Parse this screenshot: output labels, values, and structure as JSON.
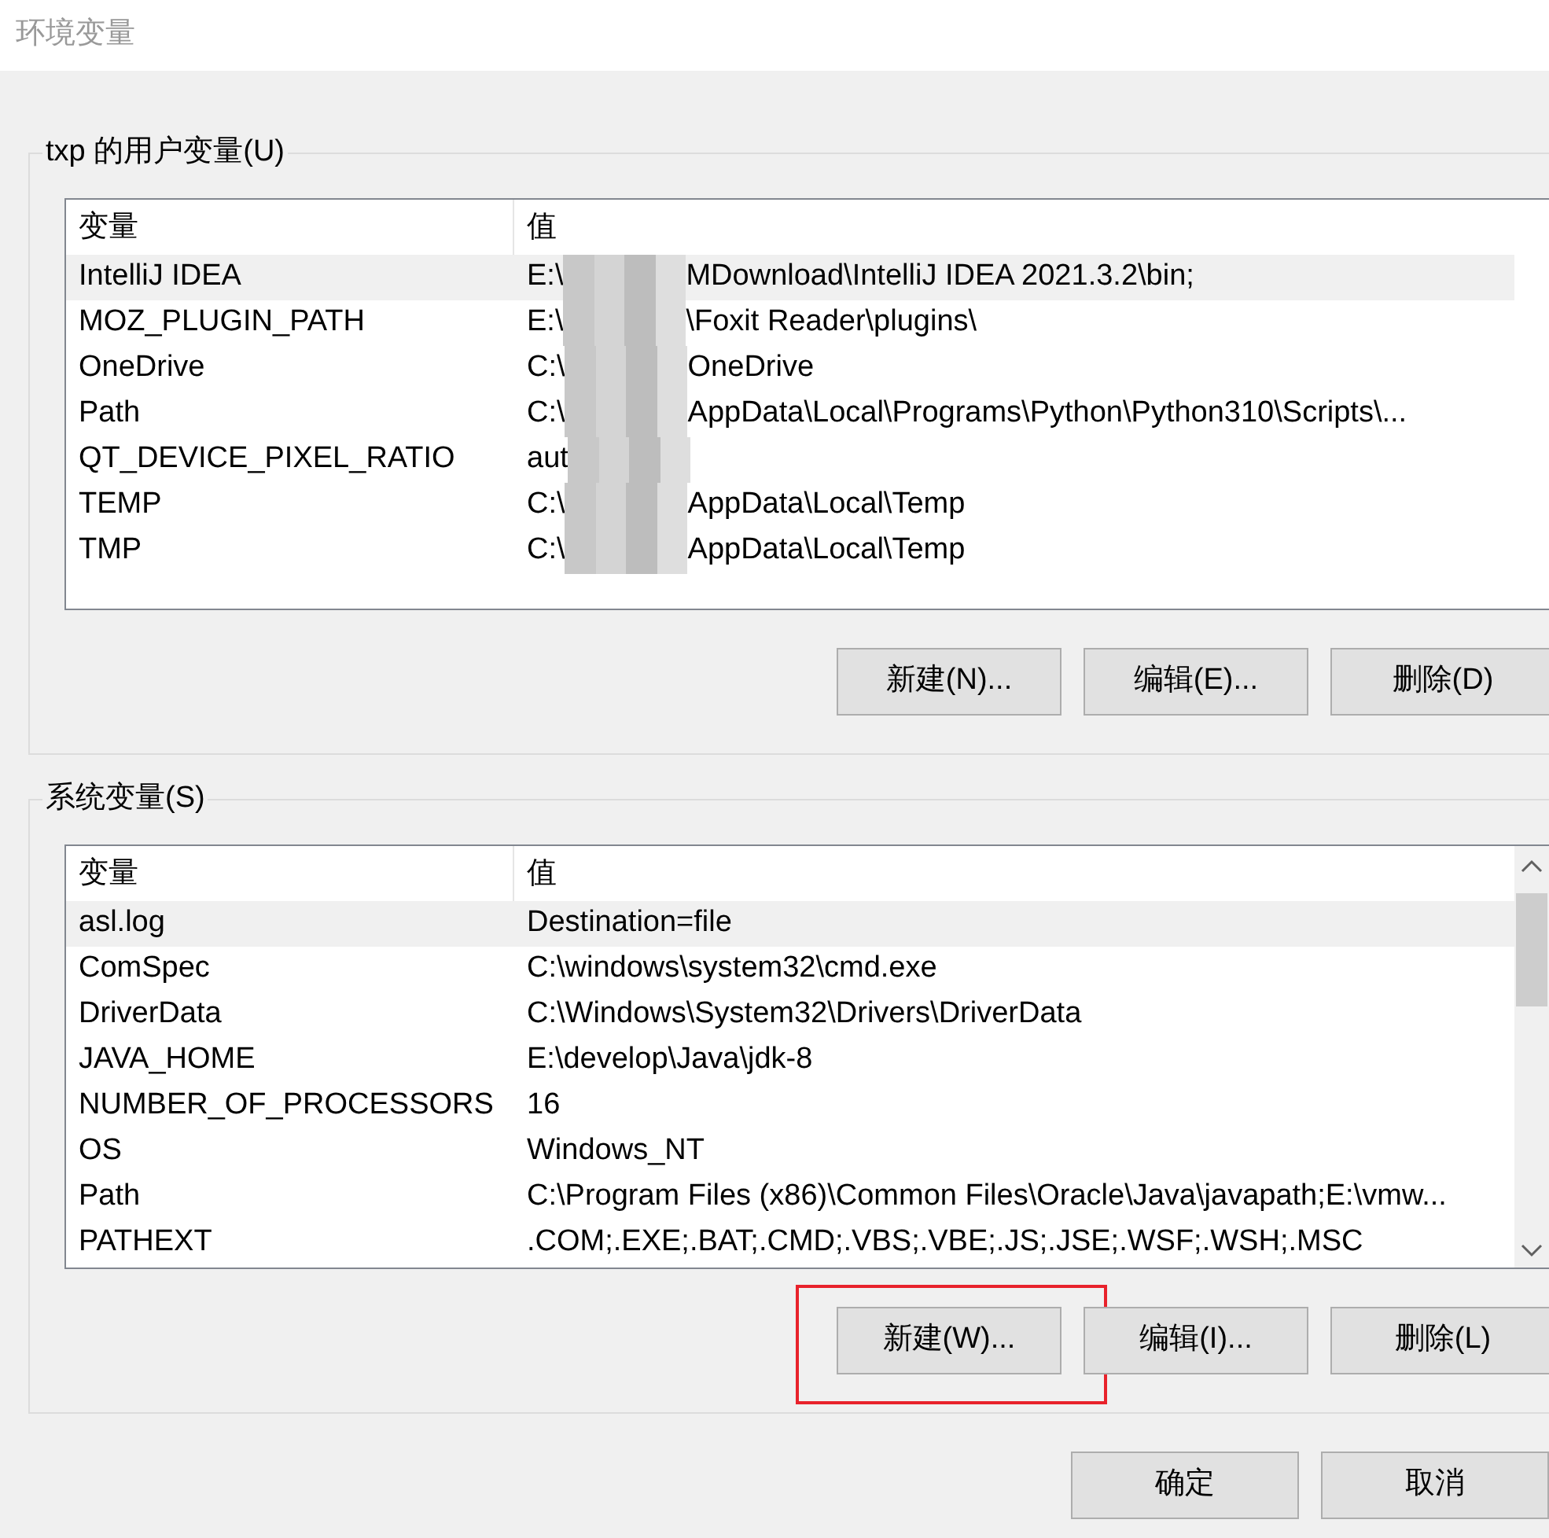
{
  "window": {
    "title": "环境变量"
  },
  "user_variables": {
    "label": "txp 的用户变量(U)",
    "columns": [
      "变量",
      "值"
    ],
    "rows": [
      {
        "name": "IntelliJ IDEA",
        "value": "E:\\",
        "value_after_redaction": "MDownload\\IntelliJ IDEA 2021.3.2\\bin;",
        "redacted": true,
        "selected": true
      },
      {
        "name": "MOZ_PLUGIN_PATH",
        "value": "E:\\",
        "value_after_redaction": "\\Foxit Reader\\plugins\\",
        "redacted": true,
        "selected": false
      },
      {
        "name": "OneDrive",
        "value": "C:\\",
        "value_after_redaction": "OneDrive",
        "redacted": true,
        "selected": false
      },
      {
        "name": "Path",
        "value": "C:\\",
        "value_after_redaction": "AppData\\Local\\Programs\\Python\\Python310\\Scripts\\...",
        "redacted": true,
        "selected": false
      },
      {
        "name": "QT_DEVICE_PIXEL_RATIO",
        "value": "aut",
        "value_after_redaction": "",
        "redacted": true,
        "selected": false
      },
      {
        "name": "TEMP",
        "value": "C:\\",
        "value_after_redaction": "AppData\\Local\\Temp",
        "redacted": true,
        "selected": false
      },
      {
        "name": "TMP",
        "value": "C:\\",
        "value_after_redaction": "AppData\\Local\\Temp",
        "redacted": true,
        "selected": false
      }
    ],
    "buttons": [
      {
        "label": "新建(N)...",
        "highlighted": false
      },
      {
        "label": "编辑(E)...",
        "highlighted": false
      },
      {
        "label": "删除(D)",
        "highlighted": false
      }
    ]
  },
  "system_variables": {
    "label": "系统变量(S)",
    "columns": [
      "变量",
      "值"
    ],
    "rows": [
      {
        "name": "asl.log",
        "value": "Destination=file",
        "redacted": false,
        "selected": true
      },
      {
        "name": "ComSpec",
        "value": "C:\\windows\\system32\\cmd.exe",
        "redacted": false,
        "selected": false
      },
      {
        "name": "DriverData",
        "value": "C:\\Windows\\System32\\Drivers\\DriverData",
        "redacted": false,
        "selected": false
      },
      {
        "name": "JAVA_HOME",
        "value": "E:\\develop\\Java\\jdk-8",
        "redacted": false,
        "selected": false
      },
      {
        "name": "NUMBER_OF_PROCESSORS",
        "value": "16",
        "redacted": false,
        "selected": false
      },
      {
        "name": "OS",
        "value": "Windows_NT",
        "redacted": false,
        "selected": false
      },
      {
        "name": "Path",
        "value": "C:\\Program Files (x86)\\Common Files\\Oracle\\Java\\javapath;E:\\vmw...",
        "redacted": false,
        "selected": false
      },
      {
        "name": "PATHEXT",
        "value": ".COM;.EXE;.BAT;.CMD;.VBS;.VBE;.JS;.JSE;.WSF;.WSH;.MSC",
        "redacted": false,
        "selected": false
      }
    ],
    "buttons": [
      {
        "label": "新建(W)...",
        "highlighted": true
      },
      {
        "label": "编辑(I)...",
        "highlighted": false
      },
      {
        "label": "删除(L)",
        "highlighted": false
      }
    ]
  },
  "dialog_buttons": [
    "确定",
    "取消"
  ]
}
